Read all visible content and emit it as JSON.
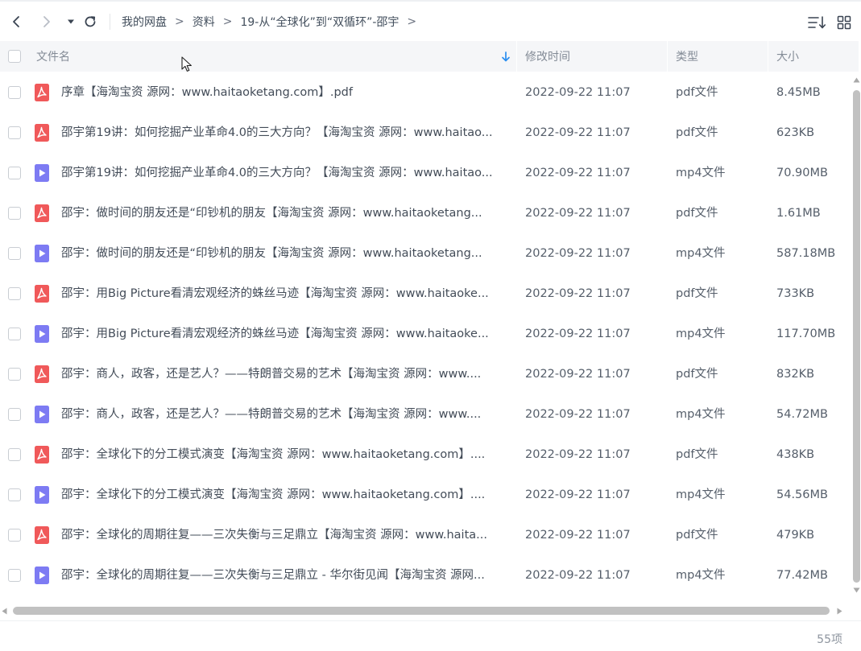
{
  "toolbar": {
    "back_icon": "chevron-left-icon",
    "forward_icon": "chevron-right-icon",
    "history_icon": "caret-down-icon",
    "refresh_icon": "refresh-icon",
    "sort_icon": "sort-list-icon",
    "grid_icon": "grid-view-icon"
  },
  "breadcrumb": [
    {
      "label": "我的网盘"
    },
    {
      "label": "资料"
    },
    {
      "label": "19-从“全球化”到“双循环”-邵宇"
    }
  ],
  "breadcrumb_sep": ">",
  "table": {
    "columns": {
      "name": "文件名",
      "modified": "修改时间",
      "type": "类型",
      "size": "大小"
    },
    "rows": [
      {
        "kind": "pdf",
        "name": "序章【海淘宝资 源网：www.haitaoketang.com】.pdf",
        "date": "2022-09-22 11:07",
        "type": "pdf文件",
        "size": "8.45MB"
      },
      {
        "kind": "pdf",
        "name": "邵宇第19讲：如何挖掘产业革命4.0的三大方向？【海淘宝资 源网：www.haitao...",
        "date": "2022-09-22 11:07",
        "type": "pdf文件",
        "size": "623KB"
      },
      {
        "kind": "mp4",
        "name": "邵宇第19讲：如何挖掘产业革命4.0的三大方向？【海淘宝资 源网：www.haitao...",
        "date": "2022-09-22 11:07",
        "type": "mp4文件",
        "size": "70.90MB"
      },
      {
        "kind": "pdf",
        "name": "邵宇：做时间的朋友还是“印钞机的朋友【海淘宝资 源网：www.haitaoketang...",
        "date": "2022-09-22 11:07",
        "type": "pdf文件",
        "size": "1.61MB"
      },
      {
        "kind": "mp4",
        "name": "邵宇：做时间的朋友还是“印钞机的朋友【海淘宝资 源网：www.haitaoketang...",
        "date": "2022-09-22 11:07",
        "type": "mp4文件",
        "size": "587.18MB"
      },
      {
        "kind": "pdf",
        "name": "邵宇：用Big Picture看清宏观经济的蛛丝马迹【海淘宝资 源网：www.haitaoke...",
        "date": "2022-09-22 11:07",
        "type": "pdf文件",
        "size": "733KB"
      },
      {
        "kind": "mp4",
        "name": "邵宇：用Big Picture看清宏观经济的蛛丝马迹【海淘宝资 源网：www.haitaoke...",
        "date": "2022-09-22 11:07",
        "type": "mp4文件",
        "size": "117.70MB"
      },
      {
        "kind": "pdf",
        "name": "邵宇：商人，政客，还是艺人？——特朗普交易的艺术【海淘宝资 源网：www....",
        "date": "2022-09-22 11:07",
        "type": "pdf文件",
        "size": "832KB"
      },
      {
        "kind": "mp4",
        "name": "邵宇：商人，政客，还是艺人？——特朗普交易的艺术【海淘宝资 源网：www....",
        "date": "2022-09-22 11:07",
        "type": "mp4文件",
        "size": "54.72MB"
      },
      {
        "kind": "pdf",
        "name": "邵宇：全球化下的分工模式演变【海淘宝资 源网：www.haitaoketang.com】....",
        "date": "2022-09-22 11:07",
        "type": "pdf文件",
        "size": "438KB"
      },
      {
        "kind": "mp4",
        "name": "邵宇：全球化下的分工模式演变【海淘宝资 源网：www.haitaoketang.com】....",
        "date": "2022-09-22 11:07",
        "type": "mp4文件",
        "size": "54.56MB"
      },
      {
        "kind": "pdf",
        "name": "邵宇：全球化的周期往复——三次失衡与三足鼎立【海淘宝资 源网：www.haita...",
        "date": "2022-09-22 11:07",
        "type": "pdf文件",
        "size": "479KB"
      },
      {
        "kind": "mp4",
        "name": "邵宇：全球化的周期往复——三次失衡与三足鼎立 - 华尔街见闻【海淘宝资 源网...",
        "date": "2022-09-22 11:07",
        "type": "mp4文件",
        "size": "77.42MB"
      }
    ]
  },
  "status": {
    "count": "55项"
  },
  "colors": {
    "pdf_icon": "#f0595a",
    "mp4_icon": "#7d7bf3",
    "sort_arrow": "#2a8ef0",
    "header_bg": "#f5f6f8"
  }
}
